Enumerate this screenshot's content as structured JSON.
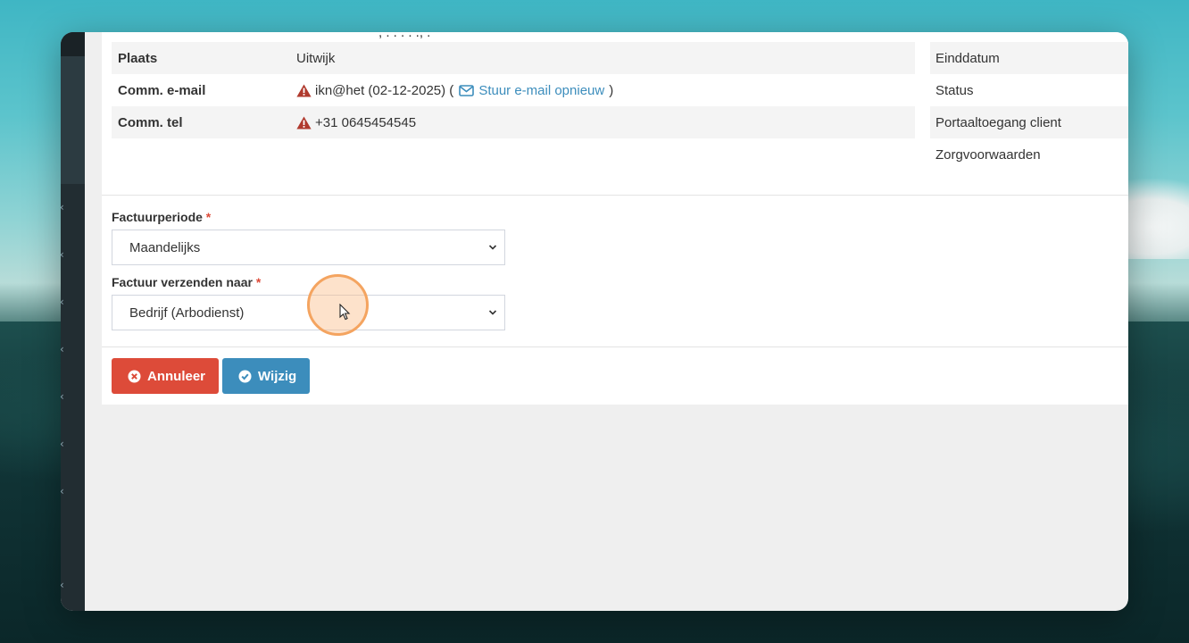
{
  "background": {
    "accent_teal": "#4bbcc8",
    "accent_dark": "#0f3234"
  },
  "cut_off_text": ", . . . . ., .",
  "details_left": [
    {
      "label": "Plaats",
      "value": "Uitwijk",
      "warning": false
    },
    {
      "label": "Comm. e-mail",
      "value": "ikn@het (02-12-2025) (",
      "warning": true,
      "action_link": "Stuur e-mail opnieuw",
      "suffix": ")"
    },
    {
      "label": "Comm. tel",
      "value": "+31 0645454545",
      "warning": true
    }
  ],
  "details_right": [
    {
      "label": "Einddatum"
    },
    {
      "label": "Status"
    },
    {
      "label": "Portaaltoegang client"
    },
    {
      "label": "Zorgvoorwaarden"
    }
  ],
  "form": {
    "invoice_period": {
      "label": "Factuurperiode",
      "required": "*",
      "value": "Maandelijks"
    },
    "send_invoice_to": {
      "label": "Factuur verzenden naar",
      "required": "*",
      "value": "Bedrijf (Arbodienst)"
    }
  },
  "buttons": {
    "cancel_label": "Annuleer",
    "save_label": "Wijzig"
  },
  "icons": {
    "warning": "warning-triangle-icon",
    "mail": "envelope-icon",
    "cancel": "times-circle-icon",
    "save": "check-circle-icon",
    "select": "chevron-down-icon"
  },
  "colors": {
    "danger": "#dd4b39",
    "primary": "#3c8dbc",
    "warning_icon": "#b03a2e",
    "sidebar": "#222d32"
  }
}
